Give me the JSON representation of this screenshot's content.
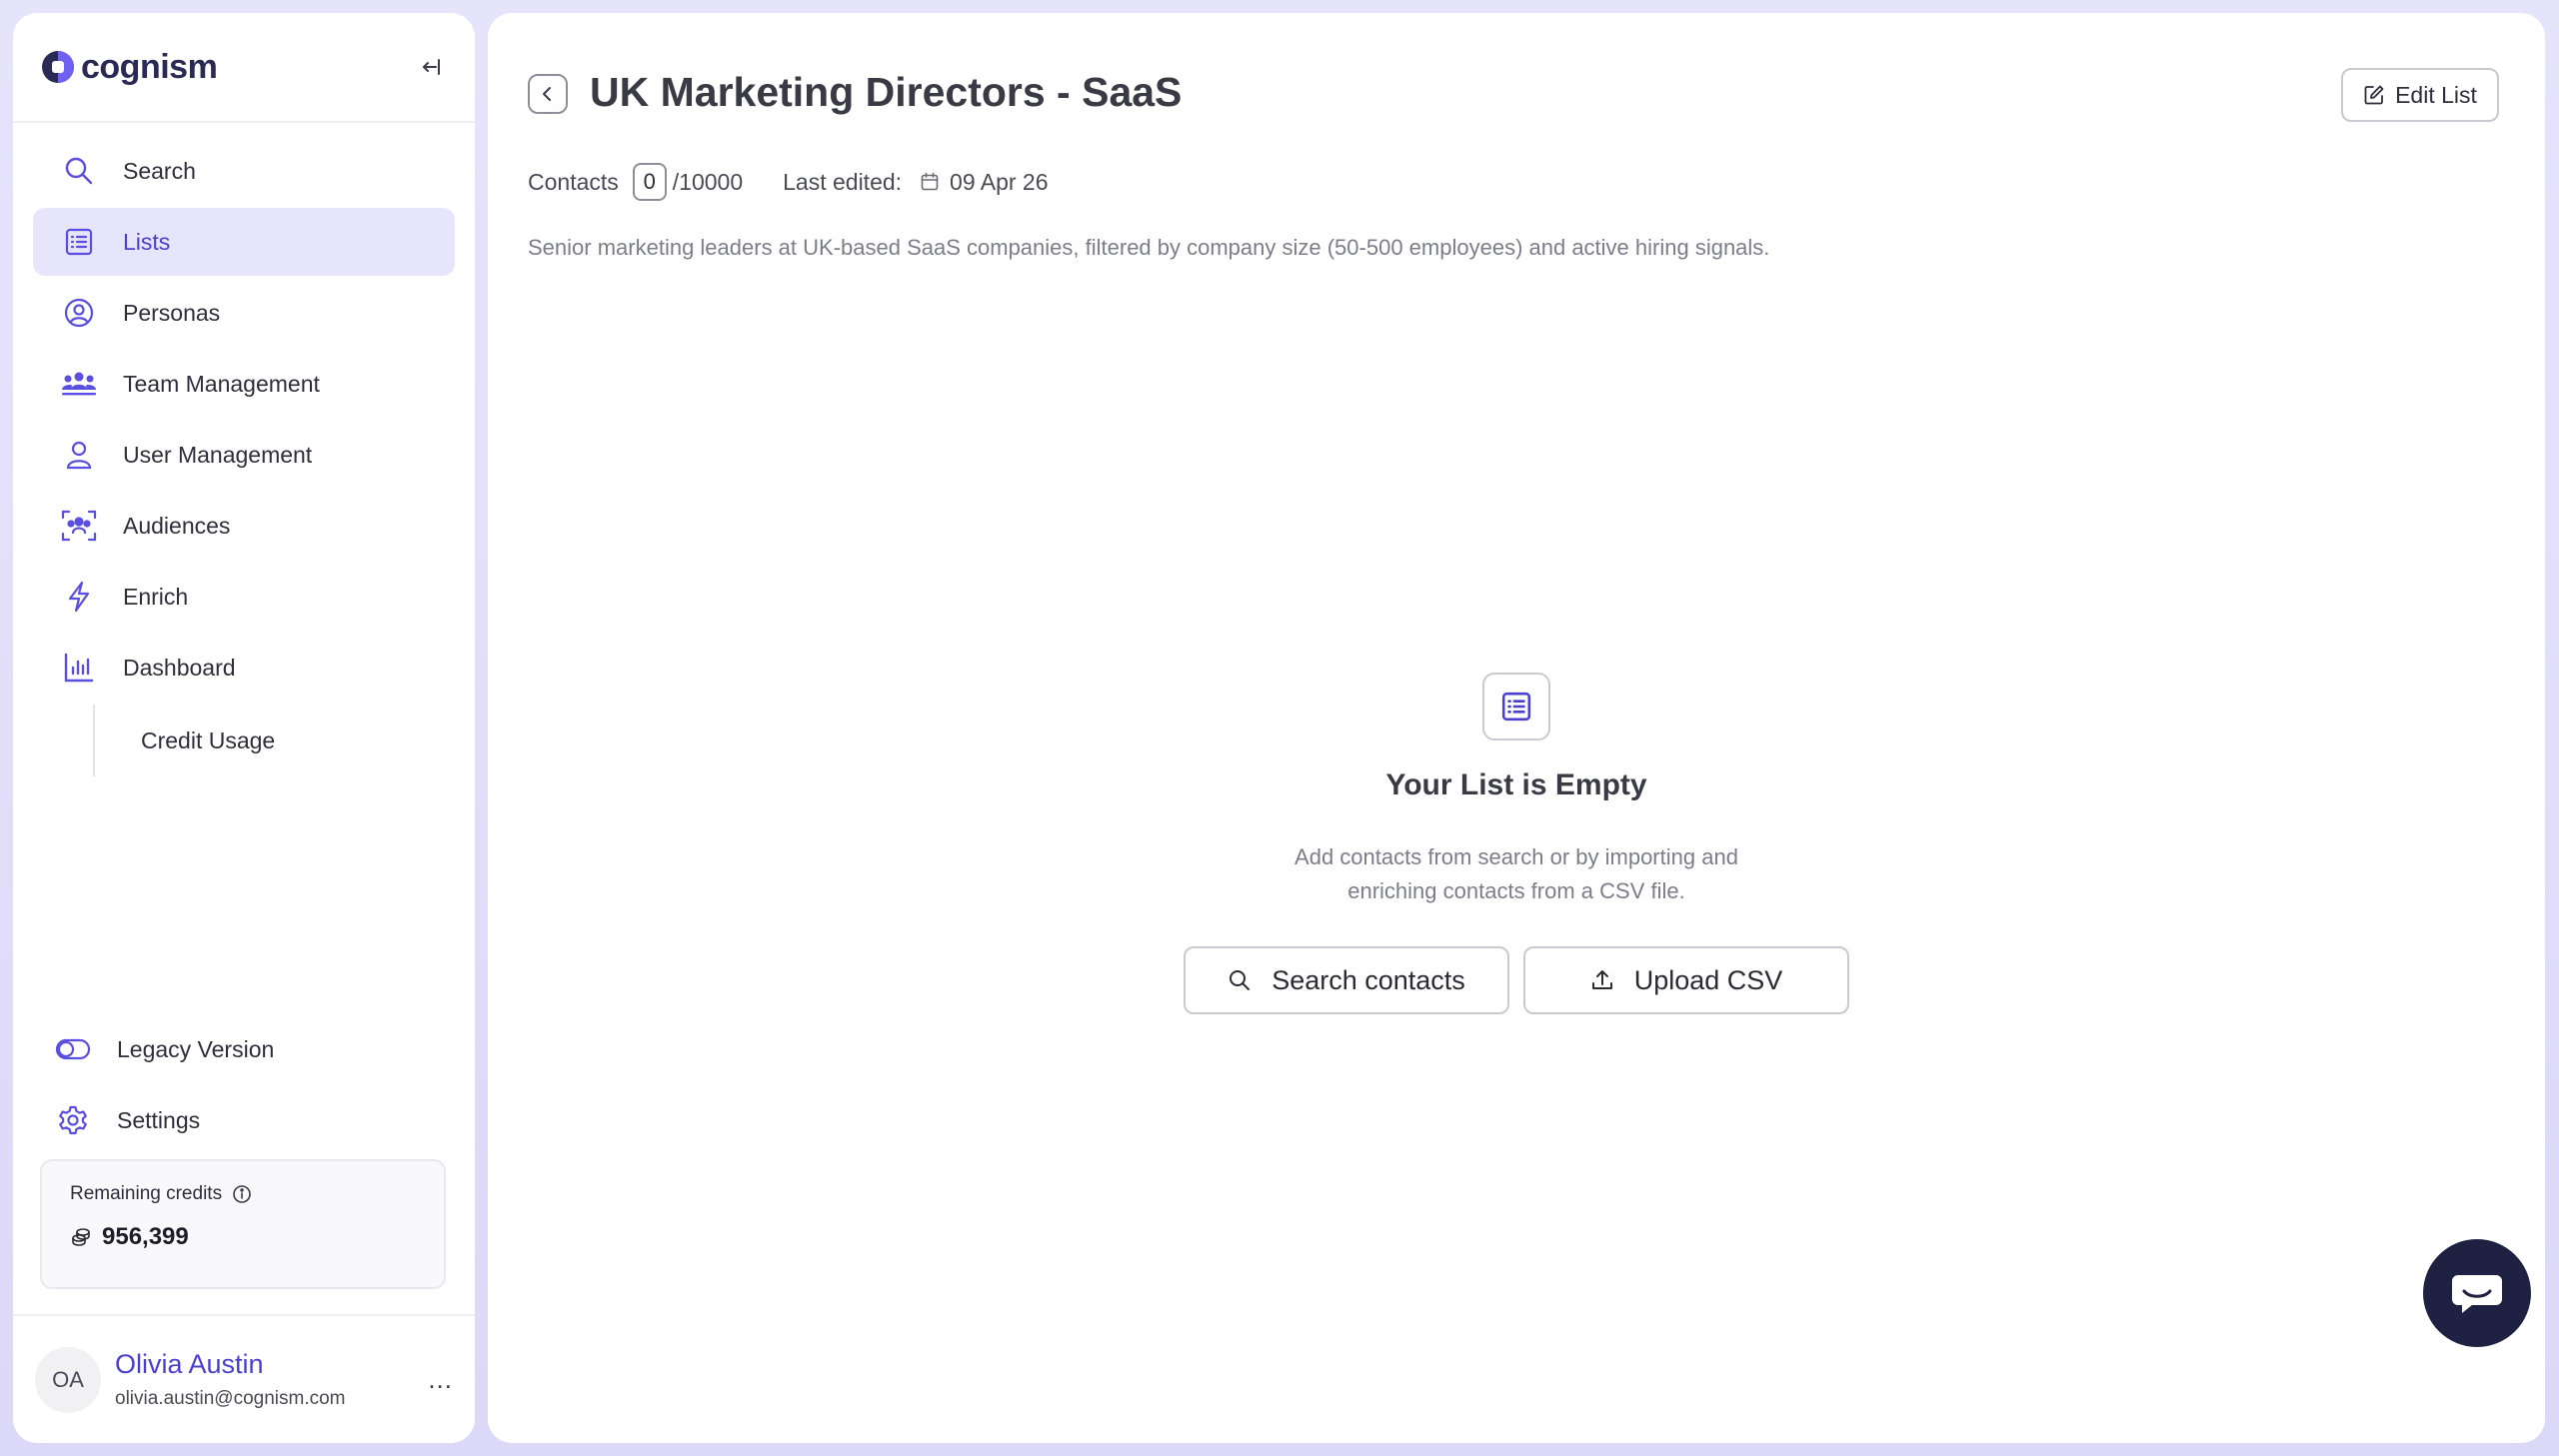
{
  "brand": {
    "name": "cognism",
    "accent": "#4b3fcf",
    "active_bg": "#e6e5fb"
  },
  "sidebar": {
    "collapse_icon": "collapse-left-icon",
    "items": [
      {
        "label": "Search",
        "icon": "search-icon",
        "active": false
      },
      {
        "label": "Lists",
        "icon": "list-icon",
        "active": true
      },
      {
        "label": "Personas",
        "icon": "persona-icon",
        "active": false
      },
      {
        "label": "Team Management",
        "icon": "team-icon",
        "active": false
      },
      {
        "label": "User Management",
        "icon": "user-icon",
        "active": false
      },
      {
        "label": "Audiences",
        "icon": "audience-icon",
        "active": false
      },
      {
        "label": "Enrich",
        "icon": "bolt-icon",
        "active": false
      },
      {
        "label": "Dashboard",
        "icon": "chart-icon",
        "active": false
      }
    ],
    "sub_items": [
      {
        "label": "Credit Usage"
      }
    ],
    "bottom_items": [
      {
        "label": "Legacy Version",
        "icon": "toggle-icon"
      },
      {
        "label": "Settings",
        "icon": "gear-icon"
      }
    ],
    "credits": {
      "label": "Remaining credits",
      "value": "956,399"
    },
    "user": {
      "initials": "OA",
      "name": "Olivia Austin",
      "email": "olivia.austin@cognism.com",
      "more": "..."
    }
  },
  "main": {
    "title": "UK Marketing Directors - SaaS",
    "edit_label": "Edit List",
    "contacts_label": "Contacts",
    "contacts_count": "0",
    "contacts_max": "/10000",
    "last_edited_label": "Last edited:",
    "last_edited_date": "09 Apr 26",
    "description": "Senior marketing leaders at UK-based SaaS companies, filtered by company size (50-500 employees) and active hiring signals.",
    "empty": {
      "title": "Your List is Empty",
      "text_line1": "Add contacts from search or by importing and",
      "text_line2": "enriching contacts from a CSV file.",
      "search_label": "Search contacts",
      "upload_label": "Upload CSV"
    }
  }
}
